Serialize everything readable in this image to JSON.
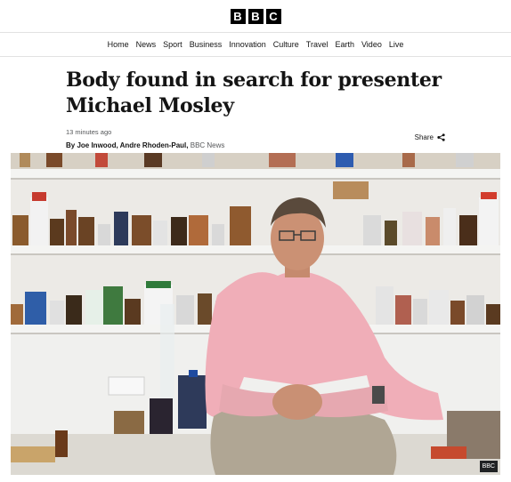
{
  "brand": {
    "letters": [
      "B",
      "B",
      "C"
    ]
  },
  "nav": {
    "items": [
      "Home",
      "News",
      "Sport",
      "Business",
      "Innovation",
      "Culture",
      "Travel",
      "Earth",
      "Video",
      "Live"
    ]
  },
  "article": {
    "headline_line1": "Body found in search for presenter",
    "headline_line2": "Michael Mosley",
    "timestamp": "13 minutes ago",
    "byline_prefix": "By Joe Inwood, Andre Rhoden-Paul,",
    "byline_org": "BBC News",
    "share_label": "Share"
  },
  "image": {
    "credit": "BBC"
  }
}
